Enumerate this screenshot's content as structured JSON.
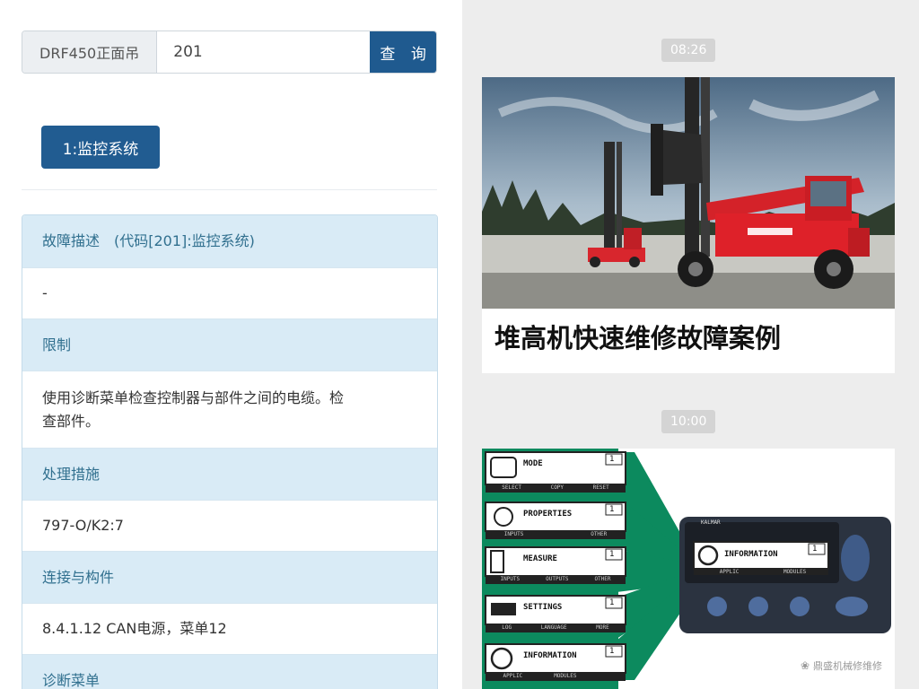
{
  "search": {
    "model": "DRF450正面吊",
    "code_value": "201",
    "button_label": "查 询"
  },
  "system_tag": "1:监控系统",
  "fault_panel": {
    "description_header": "故障描述　(代码[201]:监控系统)",
    "description_value": "-",
    "restriction_header": "限制",
    "restriction_value_line1": "使用诊断菜单检查控制器与部件之间的电缆。检",
    "restriction_value_line2": "查部件。",
    "action_header": "处理措施",
    "action_value": "797-O/K2:7",
    "connection_header": "连接与构件",
    "connection_value": "8.4.1.12 CAN电源，菜单12",
    "diagnostic_header": "诊断菜单"
  },
  "chat": {
    "time1": "08:26",
    "article_title": "堆高机快速维修故障案例",
    "time2": "10:00",
    "brand_small": "KALMAR",
    "menu_items": [
      {
        "label": "MODE",
        "sub": [
          "SELECT",
          "COPY",
          "RESET"
        ],
        "num": "1"
      },
      {
        "label": "PROPERTIES",
        "sub": [
          "INPUTS",
          "",
          "OTHER"
        ],
        "num": "1"
      },
      {
        "label": "MEASURE",
        "sub": [
          "INPUTS",
          "OUTPUTS",
          "OTHER"
        ],
        "num": "1"
      },
      {
        "label": "SETTINGS",
        "sub": [
          "LOG",
          "LANGUAGE",
          "MORE"
        ],
        "num": "1"
      },
      {
        "label": "INFORMATION",
        "sub": [
          "APPLIC",
          "MODULES",
          ""
        ],
        "num": "1"
      }
    ],
    "device_screen_label": "INFORMATION",
    "device_screen_sub": [
      "APPLIC",
      "MODULES"
    ],
    "device_screen_num": "1",
    "watermark": "鼎盛机械修维修"
  },
  "colors": {
    "search_button": "#1f5a8f",
    "panel_header_bg": "#d9ebf6",
    "panel_header_text": "#31708f",
    "chat_bg": "#ededed",
    "menu_green": "#0c8a5e",
    "forklift_red": "#e0202a"
  }
}
